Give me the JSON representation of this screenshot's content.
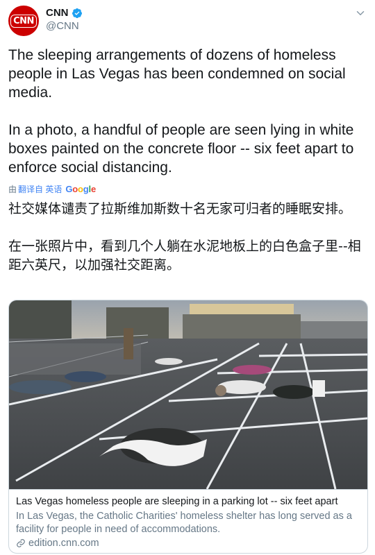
{
  "tweet": {
    "display_name": "CNN",
    "handle": "@CNN",
    "avatar_text": "CNN",
    "verified": true,
    "paragraphs": [
      "The sleeping arrangements of dozens of homeless people in Las Vegas has been condemned on social media.",
      "In a photo, a handful of people are seen lying in white boxes painted on the concrete floor -- six feet apart to enforce social distancing."
    ]
  },
  "translation": {
    "prefix": "由",
    "link_text": "翻译自 英语",
    "provider": "Google",
    "paragraphs": [
      "社交媒体谴责了拉斯维加斯数十名无家可归者的睡眠安排。",
      "在一张照片中，看到几个人躺在水泥地板上的白色盒子里--相距六英尺，以加强社交距离。"
    ]
  },
  "card": {
    "title": "Las Vegas homeless people are sleeping in a parking lot -- six feet apart",
    "description": "In Las Vegas, the Catholic Charities' homeless shelter has long served as a facility for people in need of accommodations.",
    "domain": "edition.cnn.com"
  },
  "colors": {
    "brand_red": "#cc0000",
    "verified_blue": "#1da1f2",
    "secondary_text": "#657786",
    "link_blue": "#4285f4"
  }
}
